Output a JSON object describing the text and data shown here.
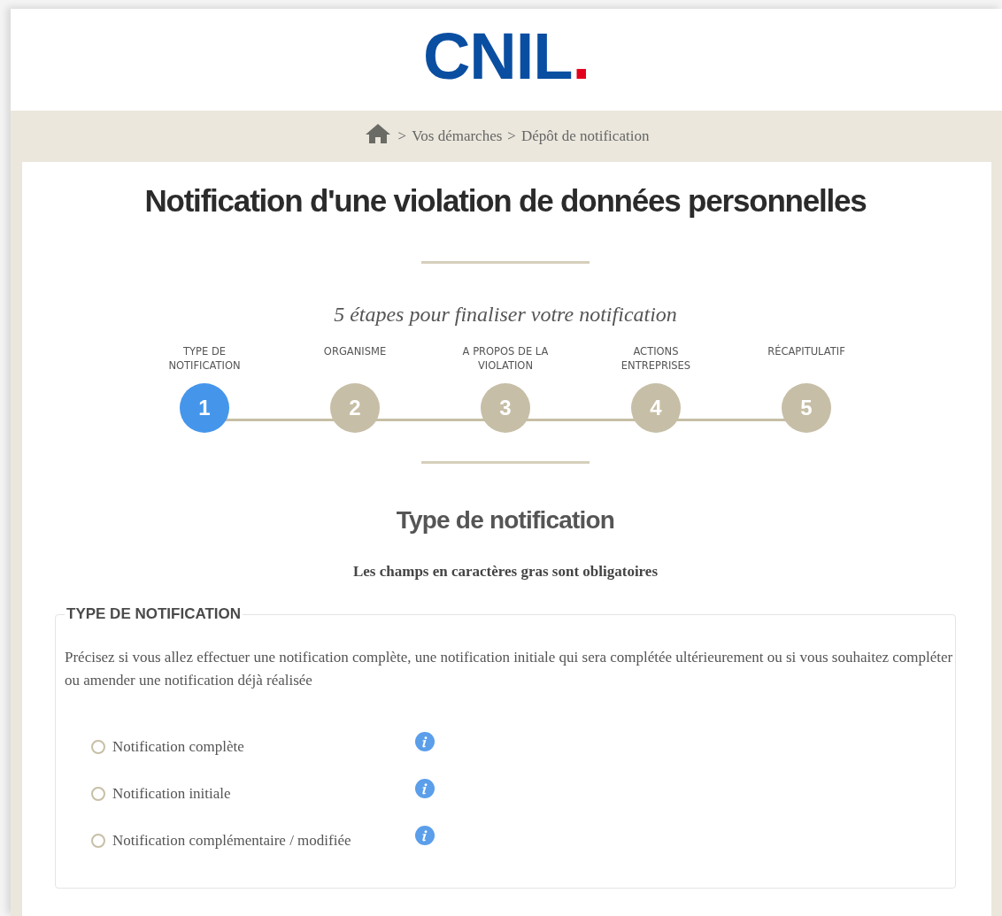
{
  "logo": {
    "name": "CNIL",
    "mark": "."
  },
  "breadcrumb": {
    "items": [
      "Vos démarches",
      "Dépôt de notification"
    ],
    "separator": ">"
  },
  "title": "Notification d'une violation de données personnelles",
  "steps_intro": "5 étapes pour finaliser votre notification",
  "steps": [
    {
      "label": "TYPE DE NOTIFICATION",
      "number": "1",
      "selected": true
    },
    {
      "label": "ORGANISME",
      "number": "2",
      "selected": false
    },
    {
      "label": "A PROPOS DE LA VIOLATION",
      "number": "3",
      "selected": false
    },
    {
      "label": "ACTIONS ENTREPRISES",
      "number": "4",
      "selected": false
    },
    {
      "label": "RÉCAPITULATIF",
      "number": "5",
      "selected": false
    }
  ],
  "section_title": "Type de notification",
  "required_note": "Les champs en caractères gras sont obligatoires",
  "fieldset": {
    "legend": "TYPE DE NOTIFICATION",
    "description": "Précisez si vous allez effectuer une notification complète, une notification initiale qui sera complétée ultérieurement ou si vous souhaitez compléter ou amender une notification déjà réalisée",
    "options": [
      {
        "label": "Notification complète",
        "selected": false
      },
      {
        "label": "Notification initiale",
        "selected": false
      },
      {
        "label": "Notification complémentaire / modifiée",
        "selected": false
      }
    ]
  }
}
